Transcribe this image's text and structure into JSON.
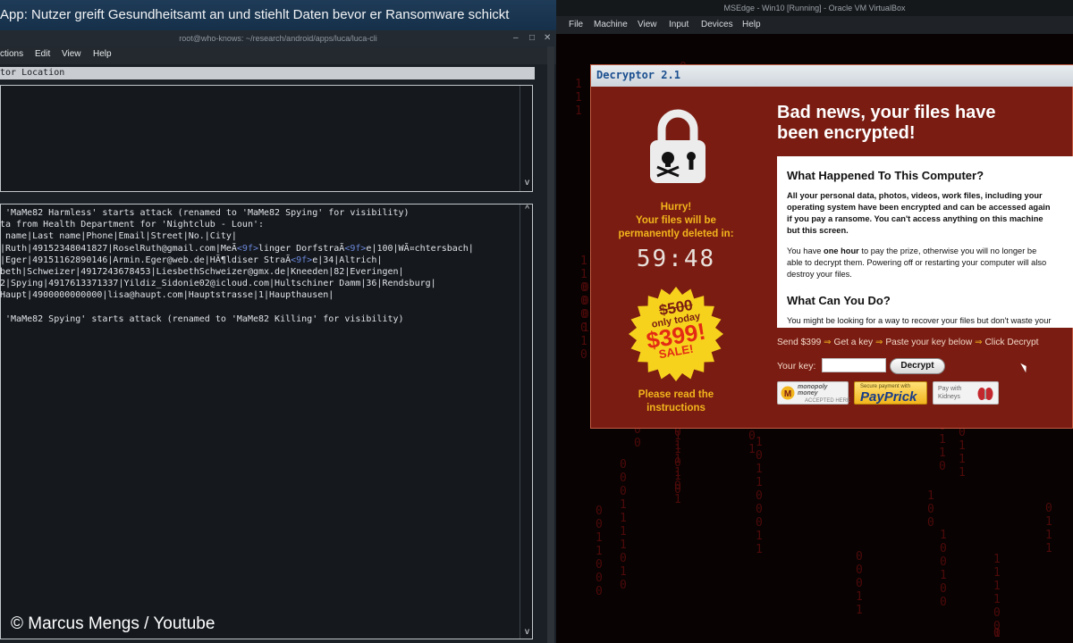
{
  "headline": "App: Nutzer greift Gesundheitsamt an und stiehlt Daten bevor er Ransomware schickt",
  "copyright": "© Marcus Mengs / Youtube",
  "terminal": {
    "title": "root@who-knows: ~/research/android/apps/luca/luca-cli",
    "menu": [
      "ctions",
      "Edit",
      "View",
      "Help"
    ],
    "location_bar": "tor Location",
    "lines": [
      [
        {
          "t": " 'MaMe82 Harmless' starts attack (renamed to 'MaMe82 Spying' for visibility)"
        }
      ],
      [
        {
          "t": "ta from Health Department for 'Nightclub - Loun':"
        }
      ],
      [
        {
          "t": " name|Last name|Phone|Email|Street|No.|City|"
        }
      ],
      [
        {
          "t": "|Ruth|49152348041827|RoselRuth@gmail.com|MeÃ"
        },
        {
          "t": "<9f>",
          "hex": true
        },
        {
          "t": "linger DorfstraÃ"
        },
        {
          "t": "<9f>",
          "hex": true
        },
        {
          "t": "e|100|WÃ¤chtersbach|"
        }
      ],
      [
        {
          "t": "|Eger|49151162890146|Armin.Eger@web.de|HÃ¶ldiser StraÃ"
        },
        {
          "t": "<9f>",
          "hex": true
        },
        {
          "t": "e|34|Altrich|"
        }
      ],
      [
        {
          "t": "beth|Schweizer|4917243678453|LiesbethSchweizer@gmx.de|Kneeden|82|Everingen|"
        }
      ],
      [
        {
          "t": "2|Spying|4917613371337|Yildiz_Sidonie02@icloud.com|Hultschiner Damm|36|Rendsburg|"
        }
      ],
      [
        {
          "t": "Haupt|4900000000000|lisa@haupt.com|Hauptstrasse|1|Haupthausen|"
        }
      ],
      [
        {
          "t": ""
        }
      ],
      [
        {
          "t": " 'MaMe82 Spying' starts attack (renamed to 'MaMe82 Killing' for visibility)"
        }
      ]
    ]
  },
  "vm": {
    "title": "MSEdge - Win10 [Running] - Oracle VM VirtualBox",
    "menu": [
      "File",
      "Machine",
      "View",
      "Input",
      "Devices",
      "Help"
    ]
  },
  "decryptor": {
    "title": "Decryptor 2.1",
    "headline": [
      "Bad news, your files have",
      "been encrypted!"
    ],
    "hurry": [
      "Hurry!",
      "Your files will be",
      "permanently deleted in:"
    ],
    "timer": "59:48",
    "price_old": "$500",
    "only_today": "only today",
    "price_new": "$399!",
    "sale": "SALE!",
    "read_instructions": [
      "Please read the",
      "instructions"
    ],
    "info": {
      "h1": "What Happened To This Computer?",
      "p1": [
        "All your personal data, photos, videos, work files, including your",
        "operating system have been encrypted and can be accessed again",
        "if you pay a ransome. You can't access anything on this machine",
        "but this screen."
      ],
      "p2_pre": "You have ",
      "p2_bold": "one hour",
      "p2_post": " to pay the prize, otherwise you will no longer be",
      "p2_rest": [
        "able to decrypt them. Powering off or restarting your computer will also",
        "destroy your files."
      ],
      "h2": "What Can You Do?",
      "p3": "You might be looking for a way to recover your files but don't waste your"
    },
    "steps": [
      "Send $399",
      "Get a key",
      "Paste your key below",
      "Click Decrypt"
    ],
    "step_arrow": "⇒",
    "key_label": "Your key:",
    "key_value": "",
    "decrypt_label": "Decrypt",
    "pay1_small": "monopoly",
    "pay1_small2": "money",
    "pay1_tiny": "ACCEPTED HERE",
    "pay2_small": "Secure payment with",
    "pay2_big": "PayPrick",
    "pay3_text": [
      "Pay with",
      "Kidneys"
    ]
  },
  "colors": {
    "ransom_red": "#7a1c12",
    "accent_yellow": "#f2b51c",
    "terminal_bg": "#1b2026",
    "hex_blue": "#6b86d8"
  },
  "icons": [
    "lock-skull-icon",
    "window-minimize-icon",
    "window-maximize-icon",
    "window-close-icon",
    "kidney-icon",
    "mouse-cursor-icon"
  ]
}
